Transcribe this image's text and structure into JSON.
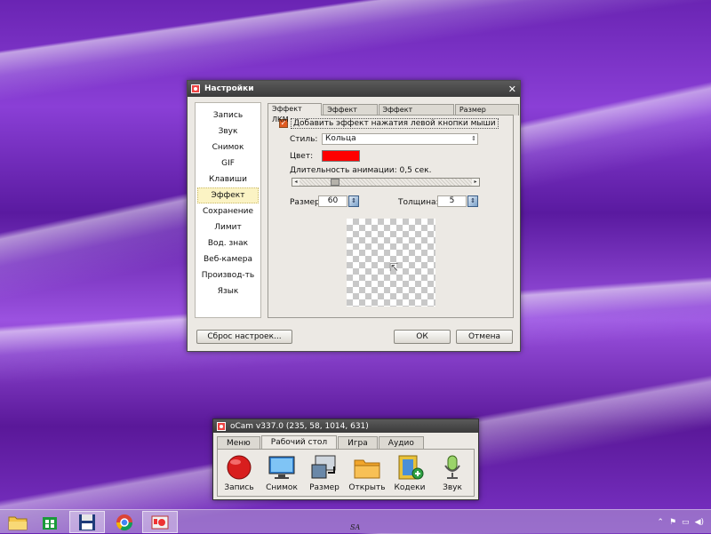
{
  "settings_dialog": {
    "title": "Настройки",
    "close_glyph": "✕",
    "sidebar": [
      {
        "label": "Запись"
      },
      {
        "label": "Звук"
      },
      {
        "label": "Снимок"
      },
      {
        "label": "GIF"
      },
      {
        "label": "Клавиши"
      },
      {
        "label": "Эффект",
        "active": true
      },
      {
        "label": "Сохранение"
      },
      {
        "label": "Лимит"
      },
      {
        "label": "Вод. знак"
      },
      {
        "label": "Веб-камера"
      },
      {
        "label": "Производ-ть"
      },
      {
        "label": "Язык"
      }
    ],
    "tabs": [
      "Эффект ЛКМ",
      "Эффект ПКМ",
      "Эффект подсветки",
      "Размер курсора"
    ],
    "active_tab": "Эффект ЛКМ",
    "panel": {
      "checkbox_label": "Добавить эффект нажатия левой кнопки мыши",
      "checkbox_checked": true,
      "style_label": "Стиль:",
      "style_value": "Кольца",
      "color_label": "Цвет:",
      "color_value": "#ff0000",
      "duration_label": "Длительность анимации: 0,5 сек.",
      "duration_fraction": 0.19,
      "size_label": "Размер:",
      "size_value": "60",
      "thickness_label": "Толщина:",
      "thickness_value": "5"
    },
    "reset_button": "Сброс настроек...",
    "ok_button": "ОК",
    "cancel_button": "Отмена"
  },
  "ocam": {
    "title": "oCam v337.0 (235, 58, 1014, 631)",
    "tabs": [
      "Меню",
      "Рабочий стол",
      "Игра",
      "Аудио"
    ],
    "active_tab": "Рабочий стол",
    "tools": [
      {
        "label": "Запись",
        "icon": "record-icon"
      },
      {
        "label": "Снимок",
        "icon": "monitor-icon"
      },
      {
        "label": "Размер",
        "icon": "resize-icon"
      },
      {
        "label": "Открыть",
        "icon": "folder-icon"
      },
      {
        "label": "Кодеки",
        "icon": "codecs-icon"
      },
      {
        "label": "Звук",
        "icon": "microphone-icon"
      }
    ]
  },
  "taskbar": {
    "items": [
      "file-explorer-icon",
      "store-icon",
      "save-app-icon",
      "chrome-icon",
      "ocam-icon"
    ],
    "tray_label": "SA"
  }
}
